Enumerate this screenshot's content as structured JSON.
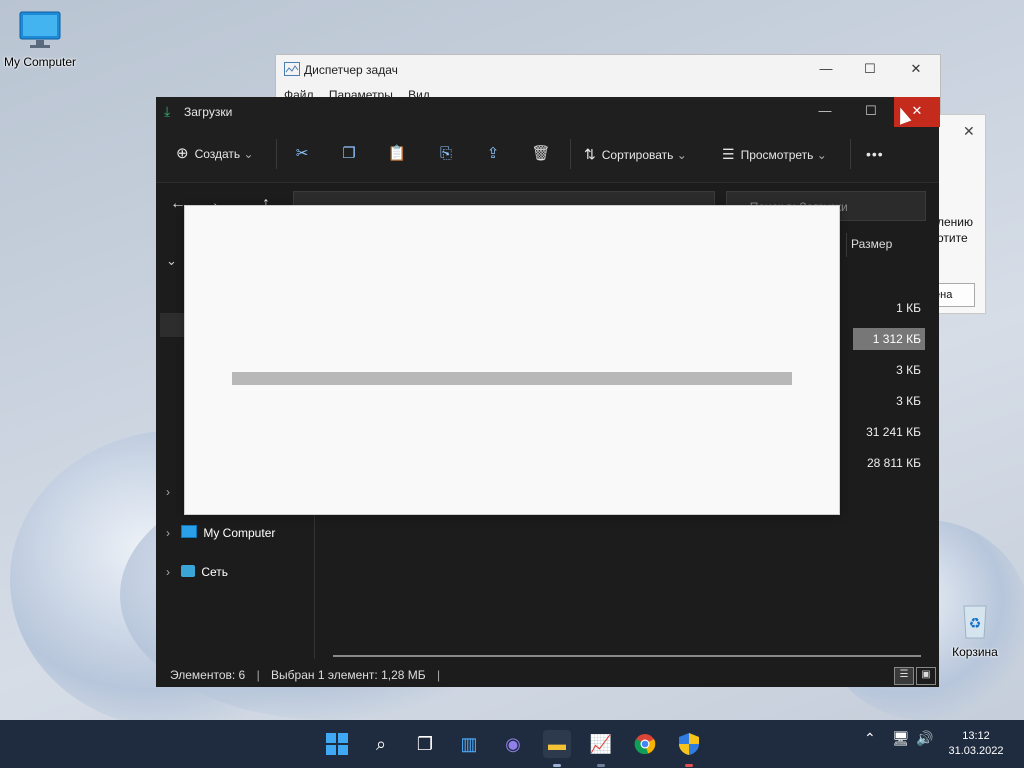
{
  "desktop": {
    "icons": [
      {
        "label": "My Computer"
      },
      {
        "label": "Корзина"
      }
    ]
  },
  "task_manager": {
    "title": "Диспетчер задач",
    "menu": [
      "Файл",
      "Параметры",
      "Вид"
    ]
  },
  "bg_dialog": {
    "line1": "лению",
    "line2": "отите",
    "button": "ена"
  },
  "explorer": {
    "title": "Загрузки",
    "toolbar": {
      "create": "Создать",
      "sort": "Сортировать",
      "view": "Просмотреть",
      "more": "•••"
    },
    "search_placeholder": "Поиск в: Загрузки",
    "column_size": "Размер",
    "sizes": [
      "1 КБ",
      "1 312 КБ",
      "3 КБ",
      "3 КБ",
      "31 241 КБ",
      "28 811 КБ"
    ],
    "selected_index": 1,
    "sidebar": [
      "My Computer",
      "Сеть"
    ],
    "status": {
      "count": "Элементов: 6",
      "selected": "Выбран 1 элемент: 1,28 МБ"
    }
  },
  "progress": {
    "fraction": 1.0
  },
  "taskbar": {
    "time": "13:12",
    "date": "31.03.2022"
  }
}
